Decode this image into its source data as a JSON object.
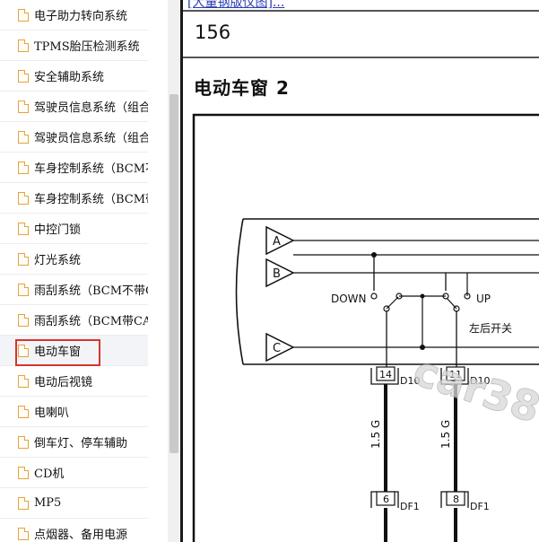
{
  "sidebar": {
    "items": [
      {
        "label": "电子助力转向系统"
      },
      {
        "label": "TPMS胎压检测系统"
      },
      {
        "label": "安全辅助系统"
      },
      {
        "label": "驾驶员信息系统（组合仪表"
      },
      {
        "label": "驾驶员信息系统（组合仪表"
      },
      {
        "label": "车身控制系统（BCM不带CAN"
      },
      {
        "label": "车身控制系统（BCM带CAN"
      },
      {
        "label": "中控门锁"
      },
      {
        "label": "灯光系统"
      },
      {
        "label": "雨刮系统（BCM不带CAN"
      },
      {
        "label": "雨刮系统（BCM带CAN）"
      },
      {
        "label": "电动车窗"
      },
      {
        "label": "电动后视镜"
      },
      {
        "label": "电喇叭"
      },
      {
        "label": "倒车灯、停车辅助"
      },
      {
        "label": "CD机"
      },
      {
        "label": "MP5"
      },
      {
        "label": "点烟器、备用电源"
      }
    ],
    "selected_index": 11
  },
  "content": {
    "top_link": "[大量钢版仪图]...",
    "page_number": "156",
    "title": "电动车窗 2"
  },
  "diagram": {
    "connector_a": "A",
    "connector_b": "B",
    "connector_c": "C",
    "switch_down": "DOWN",
    "switch_up": "UP",
    "switch_label": "左后开关",
    "pin1_num": "14",
    "pin1_conn": "D10",
    "pin2_num": "11",
    "pin2_conn": "D10",
    "wire1": "1.5 G",
    "wire2": "1.5 G",
    "pin3_num": "6",
    "pin3_conn": "DF1",
    "pin4_num": "8",
    "pin4_conn": "DF1",
    "watermark": "car38"
  }
}
